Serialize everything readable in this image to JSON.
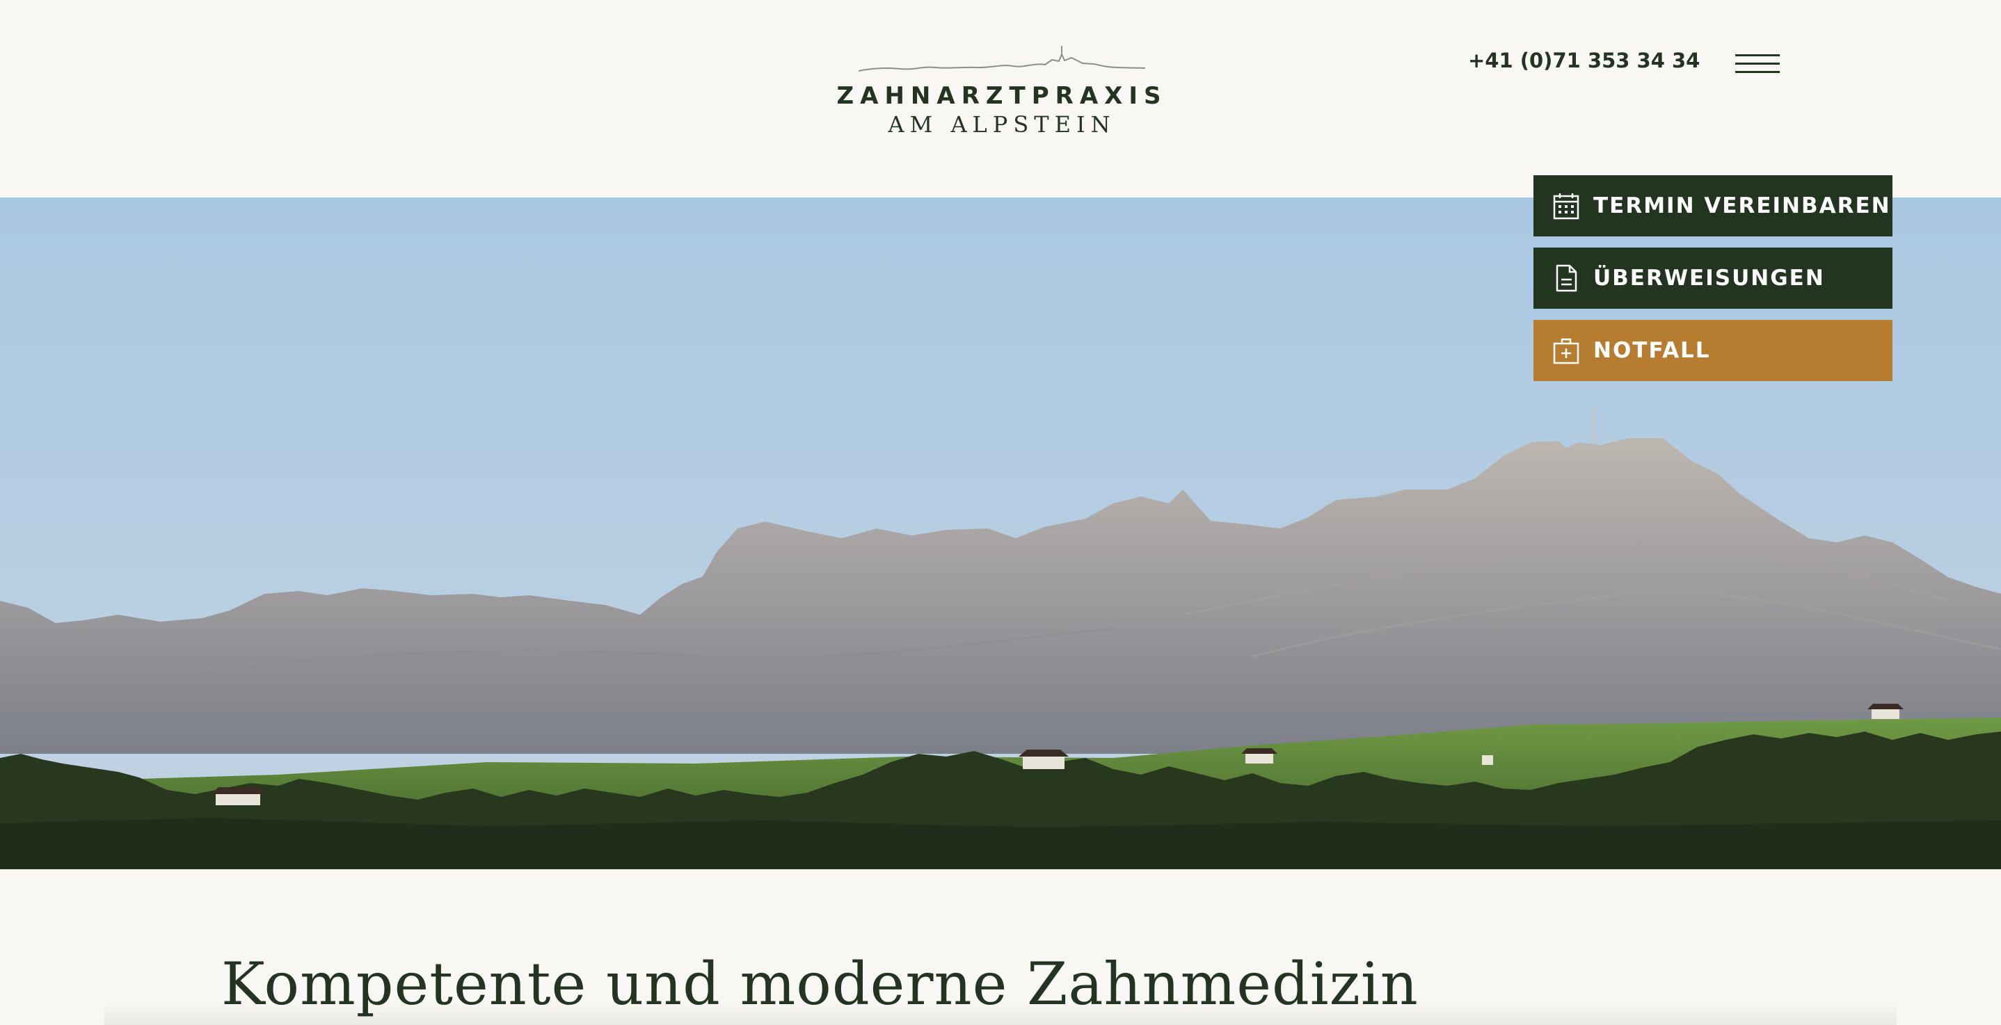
{
  "header": {
    "logo_line1": "ZAHNARZTPRAXIS",
    "logo_line2": "AM ALPSTEIN",
    "phone": "+41 (0)71 353 34 34"
  },
  "actions": [
    {
      "label": "TERMIN VEREINBAREN",
      "icon": "calendar-icon",
      "color": "#233421"
    },
    {
      "label": "ÜBERWEISUNGEN",
      "icon": "document-icon",
      "color": "#233421"
    },
    {
      "label": "NOTFALL",
      "icon": "first-aid-kit-icon",
      "color": "#b67c2f"
    }
  ],
  "main": {
    "heading": "Kompetente und moderne Zahnmedizin"
  },
  "colors": {
    "background": "#f8f7f3",
    "brand_green": "#233421",
    "accent_gold": "#b67c2f"
  }
}
